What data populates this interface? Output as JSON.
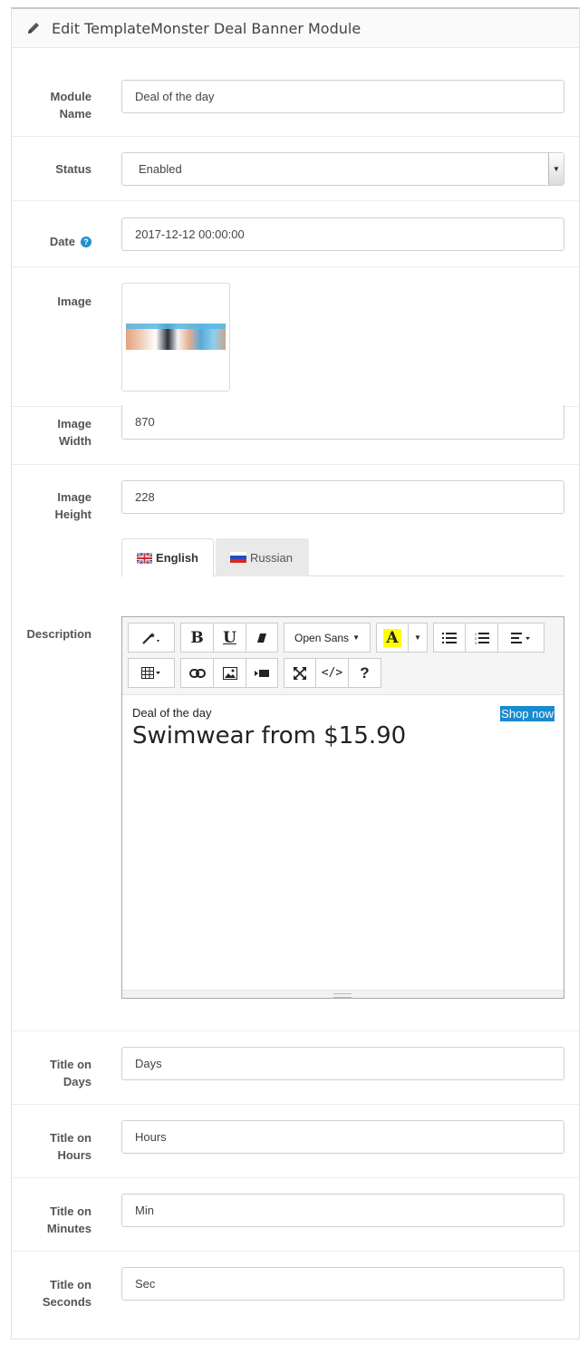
{
  "panel": {
    "title": "Edit TemplateMonster Deal Banner Module",
    "title_icon": "pencil-icon"
  },
  "fields": {
    "module_name": {
      "label_line1": "Module",
      "label_line2": "Name",
      "value": "Deal of the day"
    },
    "status": {
      "label": "Status",
      "value": "Enabled"
    },
    "date": {
      "label": "Date",
      "value": "2017-12-12 00:00:00",
      "help_icon": "question-circle-icon"
    },
    "image": {
      "label": "Image"
    },
    "image_width": {
      "label_line1": "Image",
      "label_line2": "Width",
      "value": "870"
    },
    "image_height": {
      "label_line1": "Image",
      "label_line2": "Height",
      "value": "228"
    }
  },
  "language_tabs": [
    {
      "label": "English",
      "flag": "uk-flag-icon",
      "active": true
    },
    {
      "label": "Russian",
      "flag": "russia-flag-icon",
      "active": false
    }
  ],
  "description": {
    "label": "Description",
    "toolbar": {
      "font_name": "Open Sans",
      "bold": "B",
      "underline": "U",
      "help": "?",
      "code": "</>",
      "highlight_letter": "A"
    },
    "content": {
      "small_text": "Deal of the day",
      "big_text": "Swimwear from $15.90",
      "link_text": "Shop now"
    }
  },
  "titles": {
    "days": {
      "label_line1": "Title on",
      "label_line2": "Days",
      "value": "Days"
    },
    "hours": {
      "label_line1": "Title on",
      "label_line2": "Hours",
      "value": "Hours"
    },
    "minutes": {
      "label_line1": "Title on",
      "label_line2": "Minutes",
      "value": "Min"
    },
    "seconds": {
      "label_line1": "Title on",
      "label_line2": "Seconds",
      "value": "Sec"
    }
  },
  "colors": {
    "accent": "#1e91cf",
    "highlight": "#ffff00",
    "link_bg": "#1a8ad0"
  }
}
